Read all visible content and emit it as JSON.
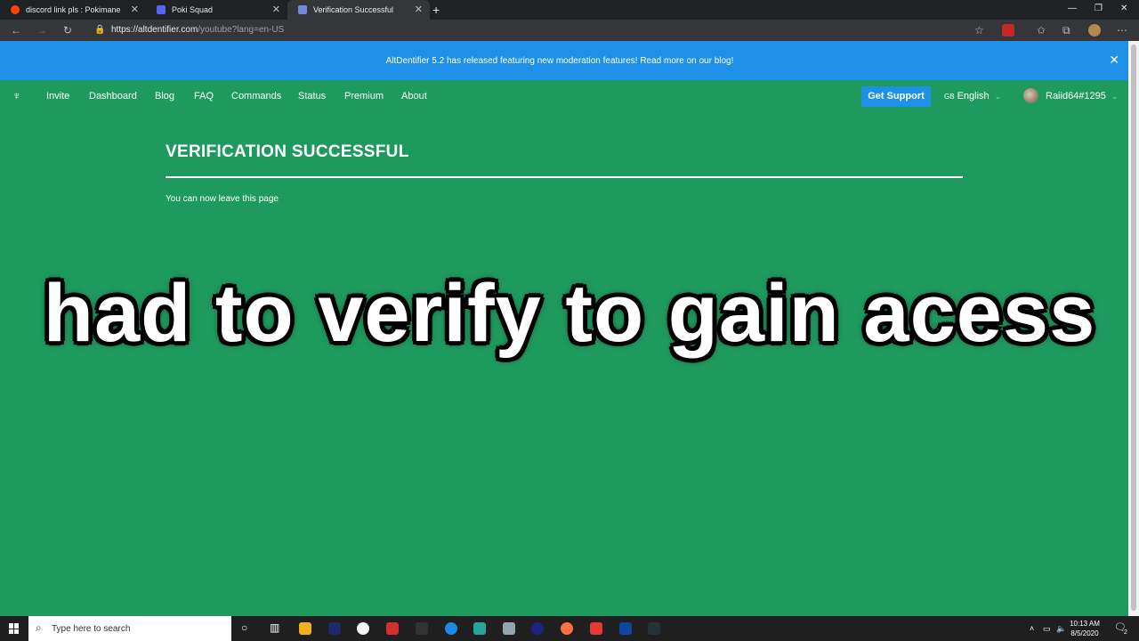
{
  "browser": {
    "tabs": [
      {
        "title": "discord link pls : Pokimane",
        "color": "#ff4500"
      },
      {
        "title": "Poki Squad",
        "color": "#5865f2"
      },
      {
        "title": "Verification Successful",
        "color": "#7289da"
      }
    ],
    "url_host": "https://altdentifier.com",
    "url_path": "/youtube?lang=en-US"
  },
  "banner": {
    "text": "AltDentifier 5.2 has released featuring new moderation features! Read more on our blog!"
  },
  "nav": {
    "links": [
      "Invite",
      "Dashboard",
      "Blog",
      "FAQ",
      "Commands",
      "Status",
      "Premium",
      "About"
    ],
    "support_label": "Get Support",
    "language_flag": "GB",
    "language": "English",
    "username": "Raiid64#1295"
  },
  "main": {
    "heading": "VERIFICATION SUCCESSFUL",
    "message": "You can now leave this page"
  },
  "caption": "had to verify to gain acess",
  "taskbar": {
    "search_placeholder": "Type here to search",
    "time": "10:13 AM",
    "date": "8/5/2020",
    "notifications": "2"
  },
  "colors": {
    "page_bg": "#1f9a5f",
    "banner_bg": "#1e90e8",
    "support_bg": "#1e90e8"
  }
}
